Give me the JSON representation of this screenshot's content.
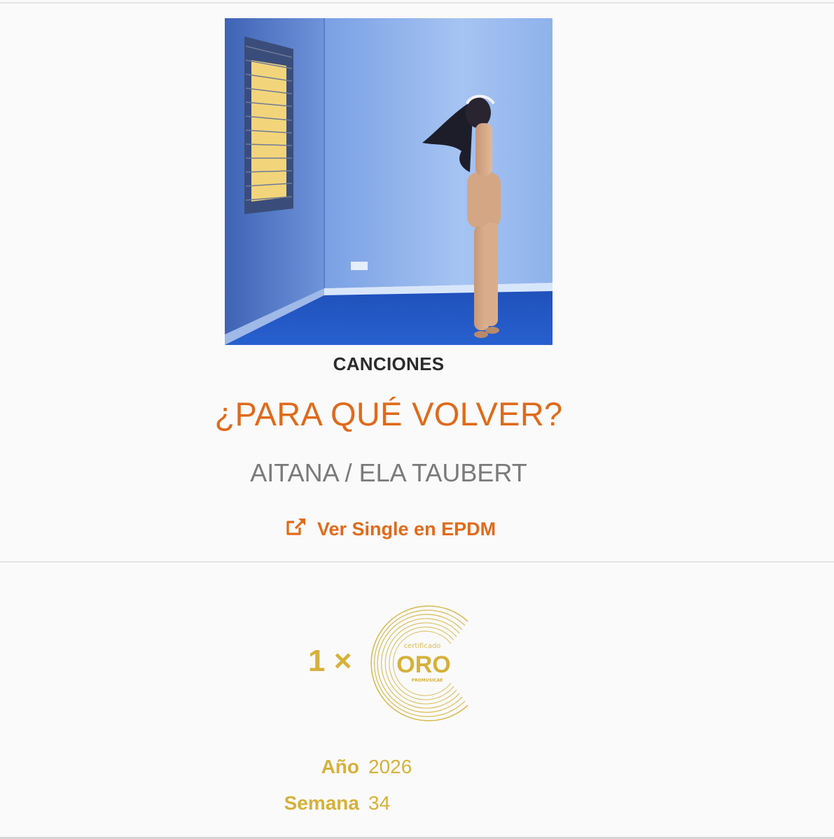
{
  "colors": {
    "accent": "#e06a1b",
    "gold": "#d6b13a",
    "artist_gray": "#7a7a7a",
    "heading": "#2b2b2b"
  },
  "header": {
    "category": "CANCIONES",
    "title": "¿PARA QUÉ VOLVER?",
    "artist": "AITANA / ELA TAUBERT"
  },
  "link": {
    "icon": "external-link-icon",
    "label": "Ver Single en EPDM"
  },
  "certification": {
    "count": "1 ×",
    "badge_top_text": "certificado",
    "badge_main_text": "ORO",
    "badge_bottom_text": "PROMUSICAE"
  },
  "facts": [
    {
      "label": "Año",
      "value": "2026"
    },
    {
      "label": "Semana",
      "value": "34"
    }
  ]
}
